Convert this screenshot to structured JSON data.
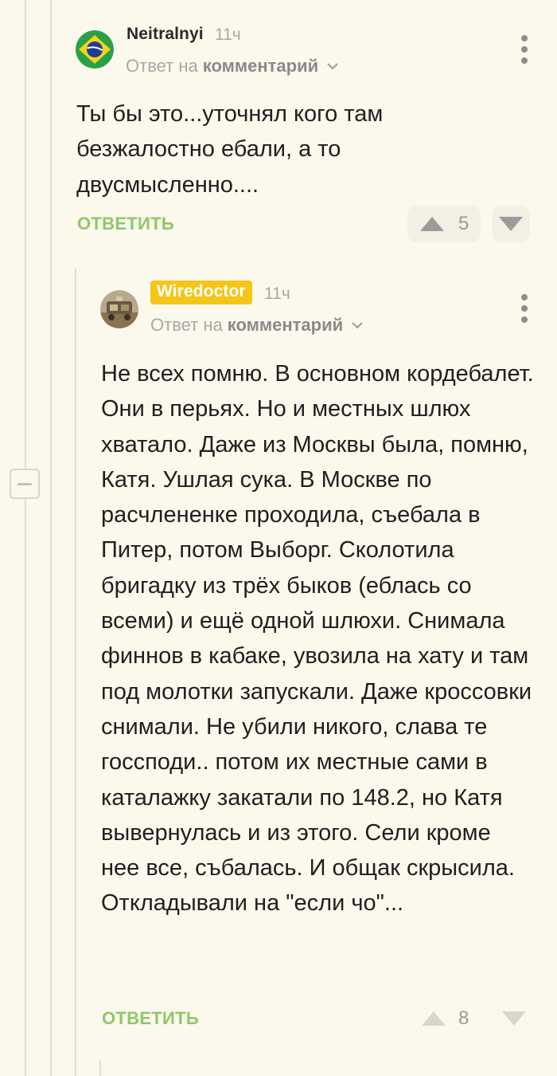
{
  "comments": [
    {
      "author": "Neitralnyi",
      "time": "11ч",
      "reply_prefix": "Ответ на",
      "reply_target": "комментарий",
      "text": "Ты бы это...уточнял кого там безжалостно ебали, а то двусмысленно....",
      "reply_label": "ОТВЕТИТЬ",
      "rating": "5",
      "avatar": "brazil-flag",
      "colors": {
        "flag_green": "#2aa04a",
        "flag_yellow": "#f6d31a",
        "flag_blue": "#1f3f95"
      }
    },
    {
      "author": "Wiredoctor",
      "author_badge": true,
      "time": "11ч",
      "reply_prefix": "Ответ на",
      "reply_target": "комментарий",
      "text": "Не всех помню. В основном кордебалет. Они в перьях. Но и местных шлюх хватало. Даже из Москвы была, помню, Катя. Ушлая сука. В Москве по расчлененке проходила, съебала в Питер, потом Выборг. Сколотила бригадку из трёх быков (еблась со всеми) и ещё одной шлюхи. Снимала финнов в кабаке, увозила на хату и там под молотки запускали. Даже кроссовки снимали. Не убили никого, слава те госсподи.. потом их местные сами в каталажку закатали по 148.2, но Катя вывернулась и из этого. Сели кроме нее все, събалась. И общак скрысила. Откладывали на \"если чо\"...",
      "reply_label": "ОТВЕТИТЬ",
      "rating": "8",
      "avatar": "photo",
      "colors": {
        "badge": "#f5c518"
      }
    }
  ],
  "colors": {
    "background": "#fbf8ec",
    "reply_link": "#8fc76a",
    "thread_line": "#e3dfd0",
    "muted_text": "#a8a8a8"
  }
}
